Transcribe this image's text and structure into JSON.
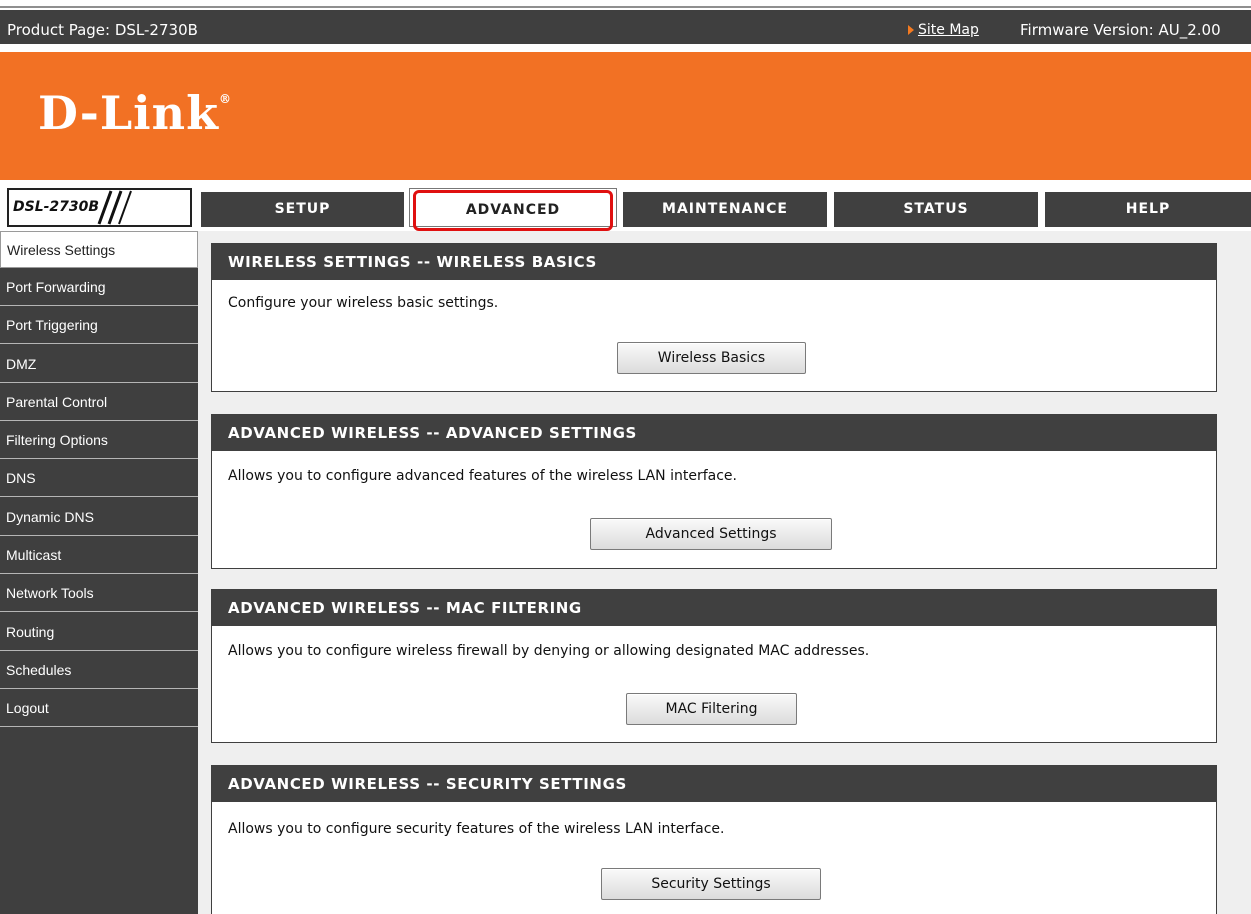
{
  "topbar": {
    "product": "Product Page: DSL-2730B",
    "sitemap": "Site Map",
    "firmware": "Firmware Version: AU_2.00"
  },
  "brand": {
    "logo": "D-Link",
    "reg": "®"
  },
  "model": {
    "label": "DSL-2730B"
  },
  "tabs": [
    {
      "label": "SETUP"
    },
    {
      "label": "ADVANCED"
    },
    {
      "label": "MAINTENANCE"
    },
    {
      "label": "STATUS"
    },
    {
      "label": "HELP"
    }
  ],
  "active_tab": "ADVANCED",
  "nav": {
    "items": [
      {
        "label": "Wireless Settings"
      },
      {
        "label": "Port Forwarding"
      },
      {
        "label": "Port Triggering"
      },
      {
        "label": "DMZ"
      },
      {
        "label": "Parental Control"
      },
      {
        "label": "Filtering Options"
      },
      {
        "label": "DNS"
      },
      {
        "label": "Dynamic DNS"
      },
      {
        "label": "Multicast"
      },
      {
        "label": "Network Tools"
      },
      {
        "label": "Routing"
      },
      {
        "label": "Schedules"
      },
      {
        "label": "Logout"
      }
    ],
    "active": "Wireless Settings"
  },
  "sections": [
    {
      "title": "WIRELESS SETTINGS -- WIRELESS BASICS",
      "description": "Configure your wireless basic settings.",
      "button": "Wireless Basics"
    },
    {
      "title": "ADVANCED WIRELESS -- ADVANCED SETTINGS",
      "description": "Allows you to configure advanced features of the wireless LAN interface.",
      "button": "Advanced Settings"
    },
    {
      "title": "ADVANCED WIRELESS -- MAC FILTERING",
      "description": "Allows you to configure wireless firewall by denying or allowing designated MAC addresses.",
      "button": "MAC Filtering"
    },
    {
      "title": "ADVANCED WIRELESS -- SECURITY SETTINGS",
      "description": "Allows you to configure security features of the wireless LAN interface.",
      "button": "Security Settings"
    }
  ],
  "colors": {
    "brand_orange": "#f27124",
    "dark_gray": "#404040",
    "highlight_red": "#e01010",
    "content_bg": "#efefef"
  }
}
